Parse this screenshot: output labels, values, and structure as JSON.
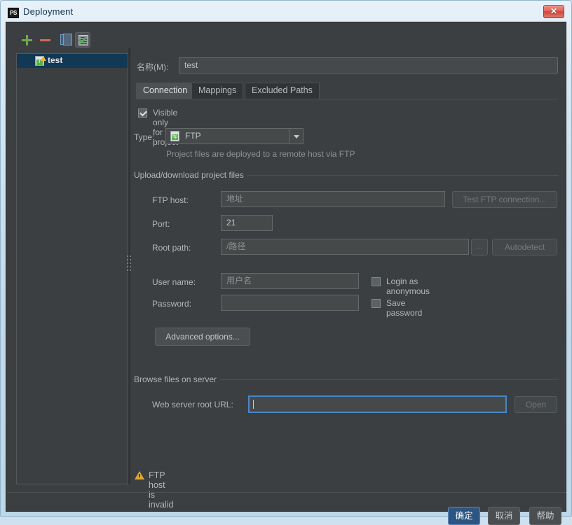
{
  "window": {
    "title": "Deployment",
    "app_icon": "phpstorm-icon",
    "close_label": "✕"
  },
  "left_panel": {
    "toolbar": [
      {
        "name": "add-server-button",
        "icon": "plus-icon",
        "tooltip": "Add"
      },
      {
        "name": "remove-server-button",
        "icon": "minus-icon",
        "tooltip": "Remove"
      },
      {
        "name": "copy-server-button",
        "icon": "copy-icon",
        "tooltip": "Copy"
      },
      {
        "name": "use-as-default-button",
        "icon": "check-document-icon",
        "tooltip": "Use as default",
        "pressed": true
      }
    ],
    "tree": [
      {
        "label": "test",
        "icon": "ftp-server-warning-icon",
        "selected": true
      }
    ]
  },
  "name_row": {
    "label": "名称(M):",
    "value": "test"
  },
  "tabs": [
    {
      "label": "Connection",
      "active": true
    },
    {
      "label": "Mappings",
      "active": false
    },
    {
      "label": "Excluded Paths",
      "active": false
    }
  ],
  "connection": {
    "visible_only_checkbox": {
      "label": "Visible only for this project",
      "checked": true
    },
    "type": {
      "label": "Type:",
      "value": "FTP",
      "icon_text": "ftp",
      "hint": "Project files are deployed to a remote host via FTP"
    },
    "group_upload": {
      "title": "Upload/download project files",
      "ftp_host": {
        "label": "FTP host:",
        "value": "",
        "placeholder": "地址"
      },
      "test_connection_button": {
        "label": "Test FTP connection...",
        "disabled": true
      },
      "port": {
        "label": "Port:",
        "value": "21"
      },
      "root_path": {
        "label": "Root path:",
        "value": "",
        "placeholder": "/路径"
      },
      "browse_button": {
        "label": "...",
        "disabled": true
      },
      "autodetect_button": {
        "label": "Autodetect",
        "disabled": true
      },
      "user_name": {
        "label": "User name:",
        "value": "",
        "placeholder": "用户名"
      },
      "login_anonymous": {
        "label": "Login as anonymous",
        "checked": false
      },
      "password": {
        "label": "Password:",
        "value": ""
      },
      "save_password": {
        "label": "Save password",
        "checked": false
      },
      "advanced_button": {
        "label": "Advanced options..."
      }
    },
    "group_browse": {
      "title": "Browse files on server",
      "web_url": {
        "label": "Web server root URL:",
        "value": "",
        "focused": true
      },
      "open_button": {
        "label": "Open",
        "disabled": true
      }
    },
    "validation": {
      "icon": "warning-icon",
      "message": "FTP host is invalid"
    }
  },
  "footer": {
    "ok": "确定",
    "cancel": "取消",
    "help": "帮助"
  }
}
